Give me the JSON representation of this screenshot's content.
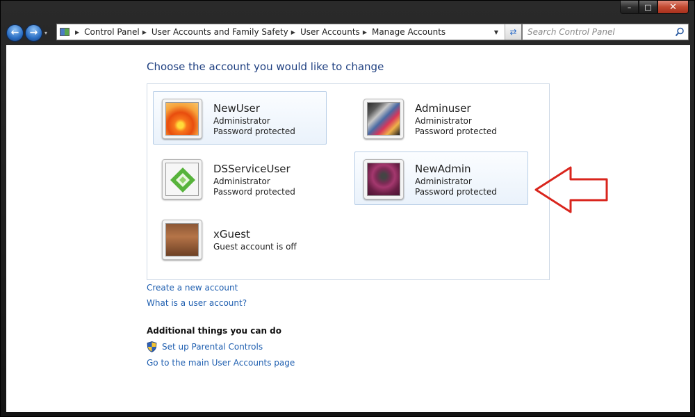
{
  "window": {
    "minimize_glyph": "–",
    "maximize_glyph": "□",
    "close_glyph": "✕"
  },
  "nav": {
    "back_icon": "back-arrow-icon",
    "forward_icon": "forward-arrow-icon",
    "back_glyph": "←",
    "forward_glyph": "→",
    "recent_glyph": "▾"
  },
  "address": {
    "crumbs": [
      "Control Panel",
      "User Accounts and Family Safety",
      "User Accounts",
      "Manage Accounts"
    ],
    "separator_glyph": "▶",
    "dropdown_glyph": "▼",
    "refresh_glyph": "⇄"
  },
  "search": {
    "placeholder": "Search Control Panel"
  },
  "main": {
    "title": "Choose the account you would like to change",
    "accounts": [
      {
        "name": "NewUser",
        "line1": "Administrator",
        "line2": "Password protected",
        "picture": "orange-flower-avatar",
        "selected": true
      },
      {
        "name": "Adminuser",
        "line1": "Administrator",
        "line2": "Password protected",
        "picture": "abstract-art-avatar",
        "selected": false
      },
      {
        "name": "DSServiceUser",
        "line1": "Administrator",
        "line2": "Password protected",
        "picture": "green-diamond-avatar",
        "selected": false
      },
      {
        "name": "NewAdmin",
        "line1": "Administrator",
        "line2": "Password protected",
        "picture": "pink-ball-avatar",
        "selected": true
      },
      {
        "name": "xGuest",
        "line1": "Guest account is off",
        "line2": "",
        "picture": "briefcase-avatar",
        "selected": false
      }
    ],
    "links": {
      "create": "Create a new account",
      "what_is": "What is a user account?"
    },
    "additional": {
      "heading": "Additional things you can do",
      "parental": "Set up Parental Controls",
      "main_page": "Go to the main User Accounts page"
    }
  },
  "annotation": {
    "arrow_color": "#d9251d"
  },
  "colors": {
    "title_blue": "#1e3f80",
    "link_blue": "#1f5fb0"
  }
}
